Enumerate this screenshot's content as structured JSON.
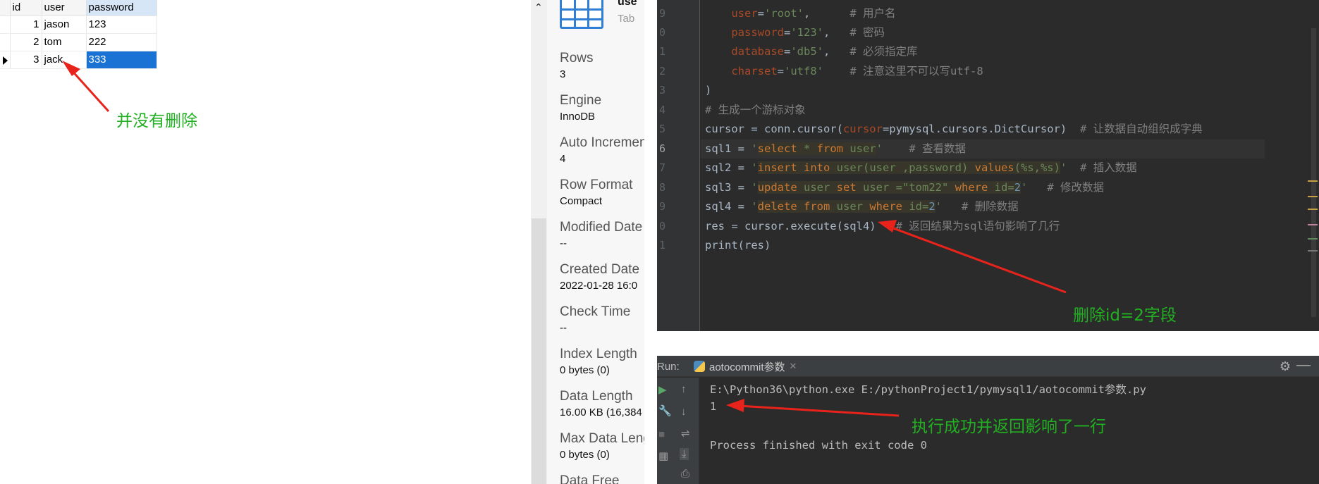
{
  "table": {
    "columns": [
      "id",
      "user",
      "password"
    ],
    "rows": [
      {
        "id": "1",
        "user": "jason",
        "password": "123"
      },
      {
        "id": "2",
        "user": "tom",
        "password": "222"
      },
      {
        "id": "3",
        "user": "jack",
        "password": "333"
      }
    ]
  },
  "annotations": {
    "not_deleted": "并没有删除",
    "delete_field": "删除id=2字段",
    "exec_success": "执行成功并返回影响了一行"
  },
  "info": {
    "name": "use",
    "subtitle": "Tab",
    "props": [
      {
        "key": "Rows",
        "value": "3"
      },
      {
        "key": "Engine",
        "value": "InnoDB"
      },
      {
        "key": "Auto Increment",
        "value": "4"
      },
      {
        "key": "Row Format",
        "value": "Compact"
      },
      {
        "key": "Modified Date",
        "value": "--"
      },
      {
        "key": "Created Date",
        "value": "2022-01-28 16:0"
      },
      {
        "key": "Check Time",
        "value": "--"
      },
      {
        "key": "Index Length",
        "value": "0 bytes (0)"
      },
      {
        "key": "Data Length",
        "value": "16.00 KB (16,384"
      },
      {
        "key": "Max Data Length",
        "value": "0 bytes (0)"
      },
      {
        "key": "Data Free",
        "value": ""
      }
    ]
  },
  "editor": {
    "line_numbers": [
      "9",
      "0",
      "1",
      "2",
      "3",
      "4",
      "5",
      "6",
      "7",
      "8",
      "9",
      "0",
      "1"
    ],
    "code": {
      "l1_name": "user",
      "l1_eq": "=",
      "l1_val": "'root'",
      "l1_tail": ",",
      "l1_cm": "# 用户名",
      "l2_name": "password",
      "l2_eq": "=",
      "l2_val": "'123'",
      "l2_tail": ",",
      "l2_cm": "# 密码",
      "l3_name": "database",
      "l3_eq": "=",
      "l3_val": "'db5'",
      "l3_tail": ",",
      "l3_cm": "# 必须指定库",
      "l4_name": "charset",
      "l4_eq": "=",
      "l4_val": "'utf8'",
      "l4_cm": "# 注意这里不可以写utf-8",
      "l5": ")",
      "l6_cm": "# 生成一个游标对象",
      "l7_a": "cursor = conn.cursor(",
      "l7_p": "cursor",
      "l7_b": "=pymysql.cursors.DictCursor)",
      "l7_cm": "# 让数据自动组织成字典",
      "l8_a": "sql1 = ",
      "l8_q1": "'",
      "l8_k1": "select",
      "l8_m1": " * ",
      "l8_k2": "from",
      "l8_m2": " user",
      "l8_q2": "'",
      "l8_cm": "# 查看数据",
      "l9_a": "sql2 = ",
      "l9_q1": "'",
      "l9_k1": "insert into",
      "l9_m1": " user(user ,password) ",
      "l9_k2": "values",
      "l9_m2": "(%s,%s)",
      "l9_q2": "'",
      "l9_cm": "# 插入数据",
      "l10_a": "sql3 = ",
      "l10_q1": "'",
      "l10_k1": "update",
      "l10_m1": " user ",
      "l10_k2": "set",
      "l10_m2": " user =\"tom22\" ",
      "l10_k3": "where",
      "l10_m3": " id=",
      "l10_n": "2",
      "l10_q2": "'",
      "l10_cm": "# 修改数据",
      "l11_a": "sql4 = ",
      "l11_q1": "'",
      "l11_k1": "delete from",
      "l11_m1": " user ",
      "l11_k2": "where",
      "l11_m2": " id=",
      "l11_n": "2",
      "l11_q2": "'",
      "l11_cm": "# 删除数据",
      "l12_a": "res = cursor.execute(sql4)",
      "l12_cm": "# 返回结果为sql语句影响了几行",
      "l13_a": "print(res)"
    }
  },
  "run": {
    "label": "Run:",
    "tab_name": "aotocommit参数",
    "console": [
      "E:\\Python36\\python.exe E:/pythonProject1/pymysql1/aotocommit参数.py",
      "1",
      "",
      "Process finished with exit code 0"
    ]
  },
  "colors": {
    "selection": "#1a73d4",
    "annotation_text": "#22b022",
    "arrow": "#e8231b",
    "editor_bg": "#2b2b2b"
  }
}
